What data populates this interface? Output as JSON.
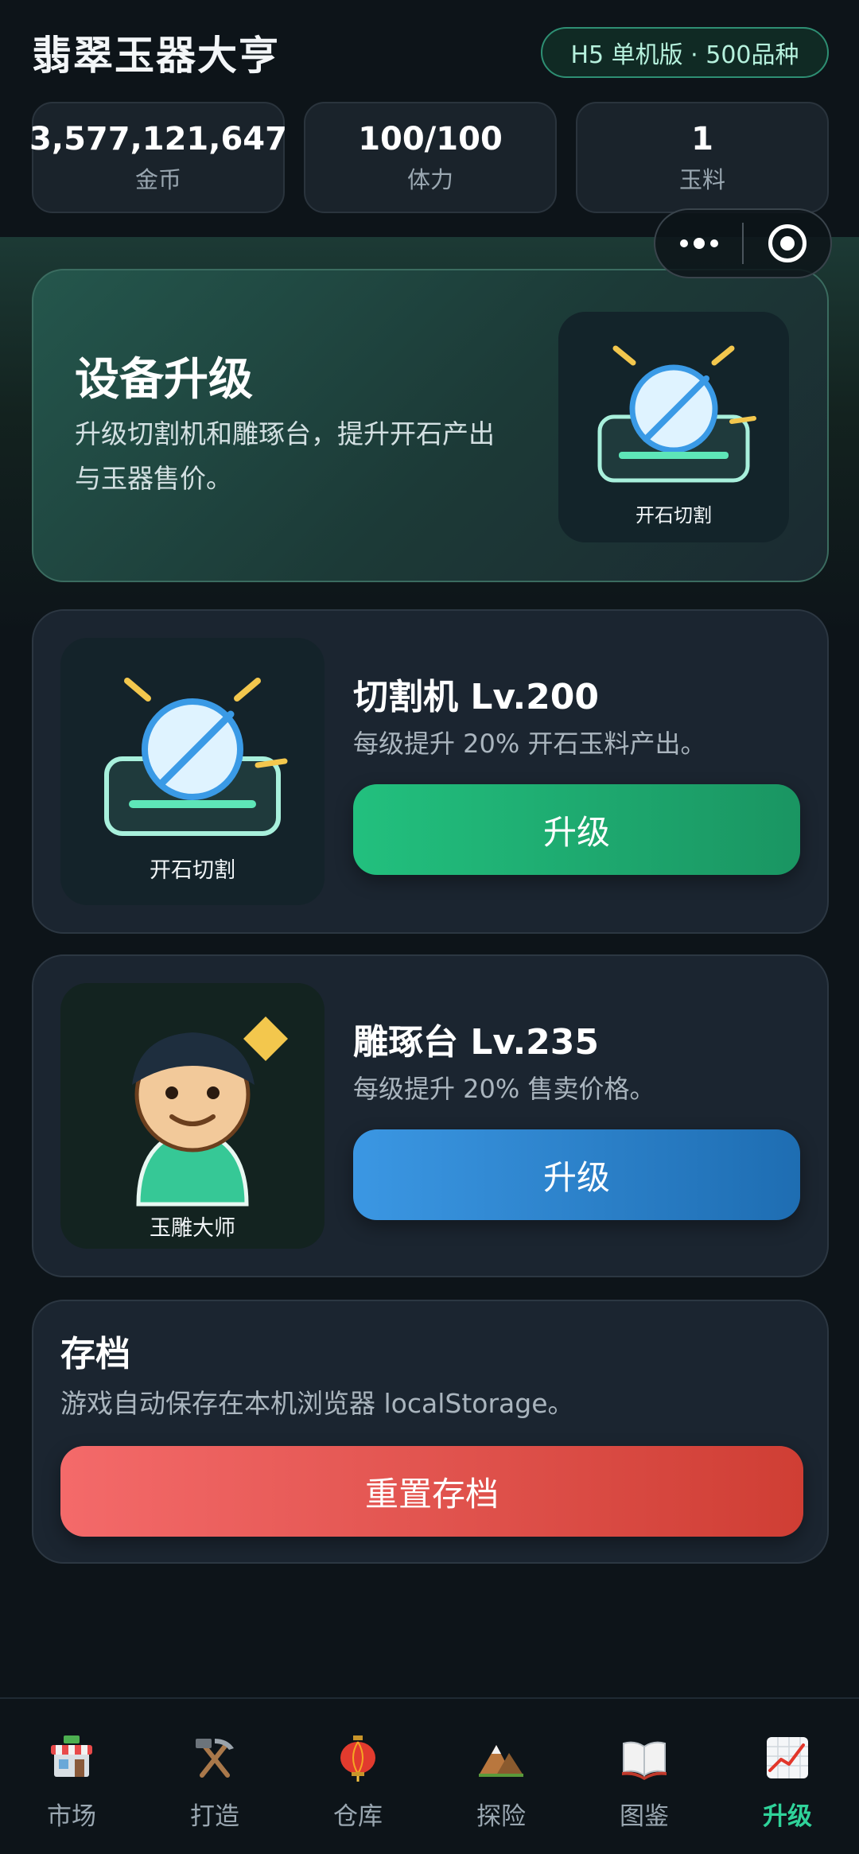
{
  "header": {
    "title": "翡翠玉器大亨",
    "badge": "H5 单机版 · 500品种"
  },
  "stats": [
    {
      "value": "3,577,121,647",
      "label": "金币"
    },
    {
      "value": "100/100",
      "label": "体力"
    },
    {
      "value": "1",
      "label": "玉料"
    }
  ],
  "hero": {
    "title": "设备升级",
    "description": "升级切割机和雕琢台，提升开石产出与玉器售价。",
    "tile_caption": "开石切割"
  },
  "cutter": {
    "title": "切割机 Lv.200",
    "description": "每级提升 20% 开石玉料产出。",
    "button": "升级",
    "tile_caption": "开石切割"
  },
  "carver": {
    "title": "雕琢台 Lv.235",
    "description": "每级提升 20% 售卖价格。",
    "button": "升级",
    "tile_caption": "玉雕大师"
  },
  "save": {
    "title": "存档",
    "description": "游戏自动保存在本机浏览器 localStorage。",
    "button": "重置存档"
  },
  "tabs": [
    {
      "label": "市场",
      "icon": "market-stall-icon"
    },
    {
      "label": "打造",
      "icon": "hammer-pick-icon"
    },
    {
      "label": "仓库",
      "icon": "lantern-icon"
    },
    {
      "label": "探险",
      "icon": "mountain-icon"
    },
    {
      "label": "图鉴",
      "icon": "open-book-icon"
    },
    {
      "label": "升级",
      "icon": "chart-up-icon",
      "active": true
    }
  ],
  "colors": {
    "accent_green": "#22c07e",
    "accent_blue": "#3b97e3",
    "danger_red": "#e0554c",
    "active_tab": "#2fd39a"
  }
}
